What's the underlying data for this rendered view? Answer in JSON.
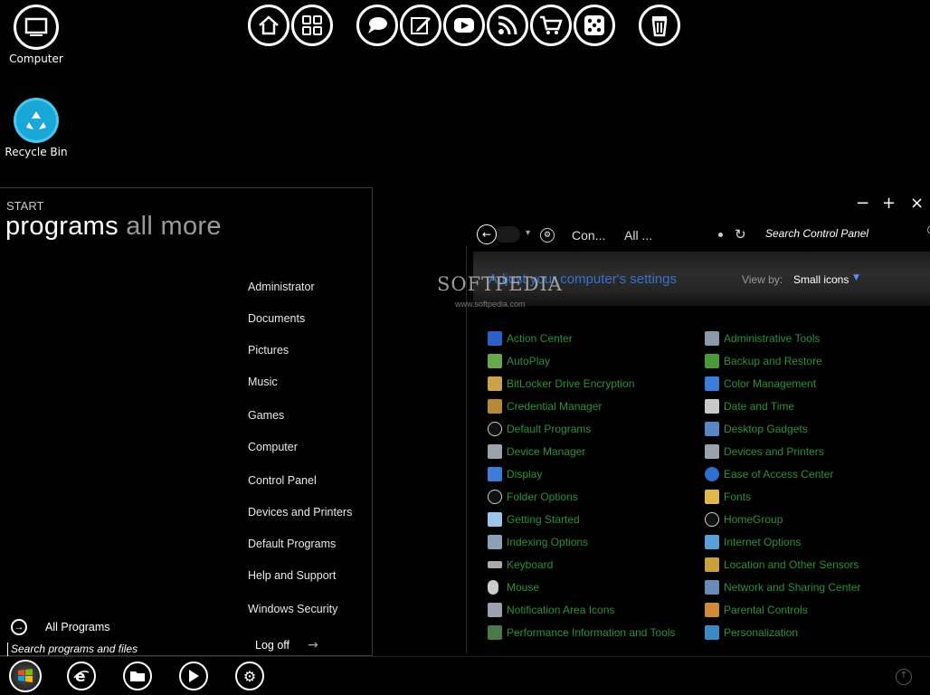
{
  "desktop": {
    "icons": [
      {
        "label": "Computer",
        "icon": "computer-icon"
      },
      {
        "label": "Recycle Bin",
        "icon": "recycle-bin-icon"
      }
    ]
  },
  "dock": {
    "buttons": [
      "home-icon",
      "apps-grid-icon",
      "chat-bubble-icon",
      "edit-note-icon",
      "play-video-icon",
      "rss-feed-icon",
      "shopping-cart-icon",
      "dice-icon",
      "trash-icon"
    ]
  },
  "start_menu": {
    "label": "START",
    "heading_active": "programs",
    "heading_rest": "all more",
    "places": [
      "Administrator",
      "Documents",
      "Pictures",
      "Music",
      "Games",
      "Computer",
      "Control Panel",
      "Devices and Printers",
      "Default Programs",
      "Help and Support",
      "Windows Security"
    ],
    "all_programs": "All Programs",
    "search_placeholder": "Search programs and files",
    "logoff": "Log off"
  },
  "control_panel": {
    "window_controls": {
      "minimize": "−",
      "maximize": "+",
      "close": "×"
    },
    "breadcrumb": [
      "Con...",
      "All ..."
    ],
    "search_placeholder": "Search Control Panel",
    "title": "Adjust your computer's settings",
    "view_by_label": "View by:",
    "view_by_value": "Small icons",
    "items_left": [
      "Action Center",
      "AutoPlay",
      "BitLocker Drive Encryption",
      "Credential Manager",
      "Default Programs",
      "Device Manager",
      "Display",
      "Folder Options",
      "Getting Started",
      "Indexing Options",
      "Keyboard",
      "Mouse",
      "Notification Area Icons",
      "Performance Information and Tools"
    ],
    "items_right": [
      "Administrative Tools",
      "Backup and Restore",
      "Color Management",
      "Date and Time",
      "Desktop Gadgets",
      "Devices and Printers",
      "Ease of Access Center",
      "Fonts",
      "HomeGroup",
      "Internet Options",
      "Location and Other Sensors",
      "Network and Sharing Center",
      "Parental Controls",
      "Personalization"
    ],
    "item_color": "#2c8f3b",
    "title_color": "#3a6fd0"
  },
  "watermark": {
    "text": "SOFTPEDIA",
    "url": "www.softpedia.com"
  },
  "taskbar": {
    "buttons": [
      "windows-start-icon",
      "internet-explorer-icon",
      "folder-icon",
      "media-play-icon",
      "settings-gear-icon"
    ]
  }
}
